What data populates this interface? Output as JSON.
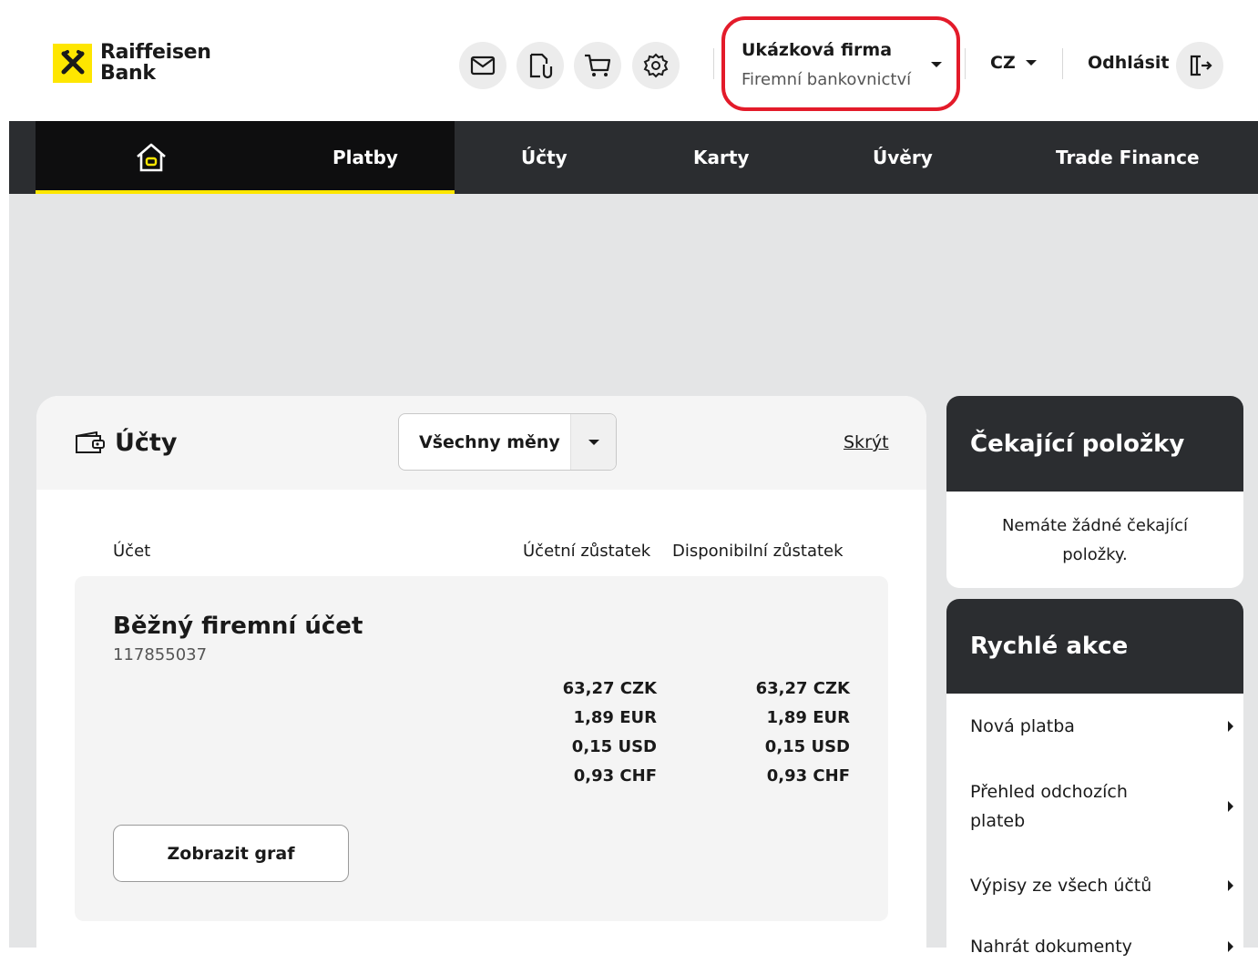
{
  "brand": {
    "name_line1": "Raiffeisen",
    "name_line2": "Bank",
    "logo_color": "#fee600"
  },
  "header": {
    "icons": [
      "mail-icon",
      "documents-icon",
      "cart-icon",
      "settings-icon"
    ],
    "company": {
      "name": "Ukázková firma",
      "subtitle": "Firemní bankovnictví"
    },
    "language": "CZ",
    "logout_label": "Odhlásit"
  },
  "nav": {
    "items": [
      {
        "label": "Platby"
      },
      {
        "label": "Účty"
      },
      {
        "label": "Karty"
      },
      {
        "label": "Úvěry"
      },
      {
        "label": "Trade Finance"
      }
    ]
  },
  "accounts": {
    "title": "Účty",
    "currency_filter": "Všechny měny",
    "hide_label": "Skrýt",
    "columns": {
      "account": "Účet",
      "ledger_balance": "Účetní zůstatek",
      "available_balance": "Disponibilní zůstatek"
    },
    "items": [
      {
        "name": "Běžný firemní účet",
        "number": "117855037",
        "ledger": [
          "63,27 CZK",
          "1,89 EUR",
          "0,15 USD",
          "0,93 CHF"
        ],
        "available": [
          "63,27 CZK",
          "1,89 EUR",
          "0,15 USD",
          "0,93 CHF"
        ],
        "graph_button": "Zobrazit graf"
      }
    ]
  },
  "pending": {
    "title": "Čekající položky",
    "empty_text": "Nemáte žádné čekající položky."
  },
  "quick_actions": {
    "title": "Rychlé akce",
    "items": [
      {
        "label": "Nová platba"
      },
      {
        "label": "Přehled odchozích plateb"
      },
      {
        "label": "Výpisy ze všech účtů"
      },
      {
        "label": "Nahrát dokumenty"
      }
    ]
  },
  "colors": {
    "accent": "#fee600",
    "nav_bg": "#2b2d30",
    "highlight_border": "#e31b2a",
    "content_bg": "#e4e5e6"
  }
}
